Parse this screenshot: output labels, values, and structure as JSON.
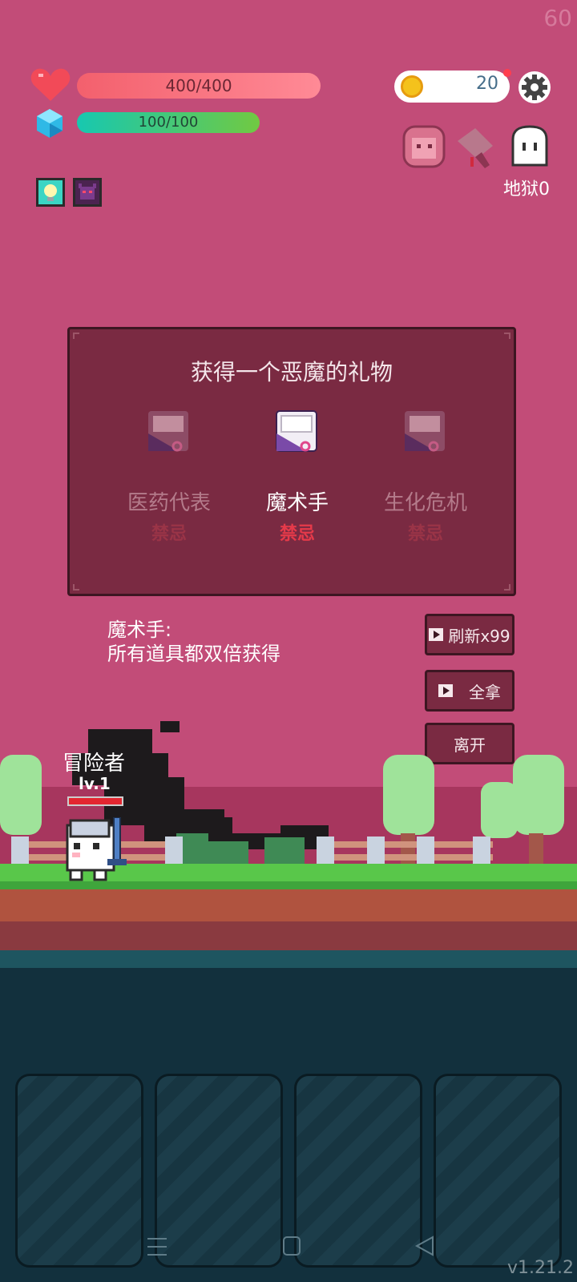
{
  "fps": "60",
  "hud": {
    "hp_text": "400/400",
    "mp_text": "100/100",
    "hp_fraction": 1.0,
    "mp_fraction": 1.0,
    "coins": "20",
    "hell_label": "地狱0",
    "buffs": [
      "bulb-buff-icon",
      "demon-buff-icon"
    ],
    "relics": [
      "girl-portrait-icon",
      "cleaver-icon",
      "ghost-icon"
    ]
  },
  "gift_panel": {
    "title": "获得一个恶魔的礼物",
    "options": [
      {
        "name": "医药代表",
        "tag": "禁忌",
        "selected": false
      },
      {
        "name": "魔术手",
        "tag": "禁忌",
        "selected": true
      },
      {
        "name": "生化危机",
        "tag": "禁忌",
        "selected": false
      }
    ]
  },
  "description": {
    "title": "魔术手:",
    "body": "所有道具都双倍获得"
  },
  "buttons": {
    "refresh": "刷新x99",
    "take_all": "全拿",
    "leave": "离开"
  },
  "hero": {
    "name": "冒险者",
    "level": "lv.1",
    "hp_fraction": 1.0
  },
  "version": "v1.21.2",
  "colors": {
    "background": "#c24c78",
    "panel": "#7a2a42",
    "tag_red": "#e63a4a",
    "grass": "#59c74a",
    "water": "#12303d"
  }
}
